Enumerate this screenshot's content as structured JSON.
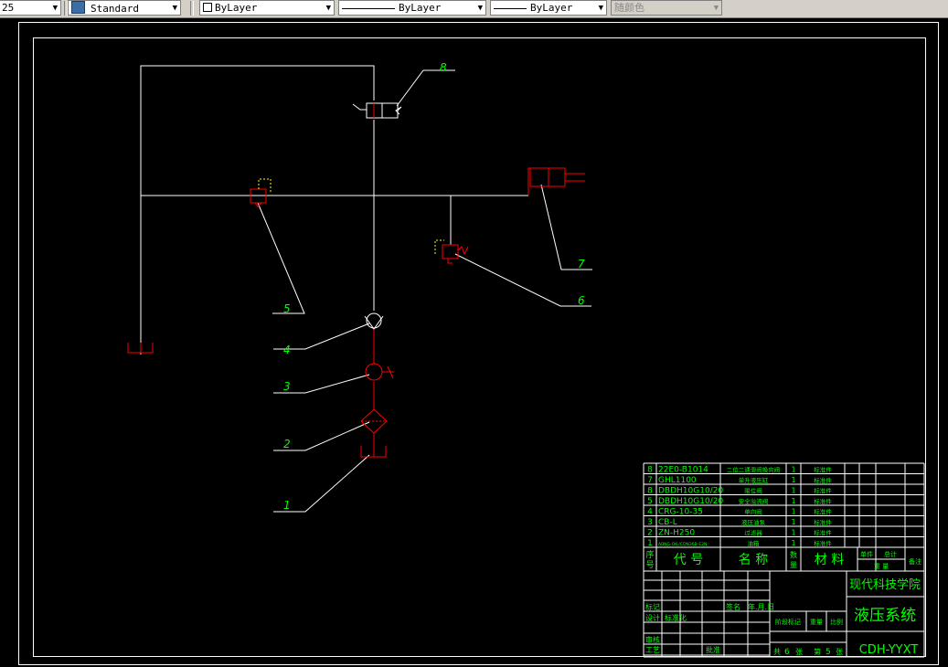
{
  "toolbar": {
    "scale_value": "25",
    "text_style": "Standard",
    "layer": "ByLayer",
    "linetype": "ByLayer",
    "lineweight": "ByLayer",
    "color": "随颜色"
  },
  "callouts": [
    "1",
    "2",
    "3",
    "4",
    "5",
    "6",
    "7",
    "8"
  ],
  "title_block": {
    "parts": [
      {
        "no": "8",
        "code": "22E0-B1014",
        "name": "二位二通滑阀换向阀",
        "qty": "1",
        "material": "标准件"
      },
      {
        "no": "7",
        "code": "GHL1100",
        "name": "单升液压缸",
        "qty": "1",
        "material": "标准件"
      },
      {
        "no": "8",
        "code": "DBDH10G10/20",
        "name": "限位阀",
        "qty": "1",
        "material": "标准件"
      },
      {
        "no": "5",
        "code": "DBDH10G10/20",
        "name": "安全溢流阀",
        "qty": "1",
        "material": "标准件"
      },
      {
        "no": "4",
        "code": "CRG-10-35",
        "name": "单向阀",
        "qty": "1",
        "material": "标准件"
      },
      {
        "no": "3",
        "code": "CB-L",
        "name": "液压油泵",
        "qty": "1",
        "material": "标准件"
      },
      {
        "no": "2",
        "code": "ZN-H250",
        "name": "过滤器",
        "qty": "1",
        "material": "标准件"
      },
      {
        "no": "1",
        "code": "ABNG-OK-/CDN36B-E2N",
        "name": "油箱",
        "qty": "1",
        "material": "标准件"
      }
    ],
    "header": {
      "no": "序号",
      "code": "代 号",
      "name": "名 称",
      "qty": "数量",
      "material": "材 料",
      "unit_weight": "单件",
      "total_weight": "总计",
      "weight_sub": "重 量",
      "remarks": "备注"
    },
    "school": "现代科技学院",
    "drawing_title": "液压系统",
    "drawing_code": "CDH-YYXT",
    "labels": {
      "mark": "标记",
      "signature": "签名",
      "date": "年.月.日",
      "design": "设计",
      "standardize": "标准化",
      "review": "审核",
      "process": "工艺",
      "approve": "批准",
      "stage_mark": "阶段标记",
      "weight": "重量",
      "scale": "比例",
      "total": "共",
      "sheets": "张",
      "sheet_no": "第",
      "page": "张"
    },
    "sheet_total": "6",
    "sheet_no": "5"
  },
  "colors": {
    "line": "#ffffff",
    "component": "#ff0000",
    "text": "#00ff00",
    "yellow": "#ffff00"
  }
}
